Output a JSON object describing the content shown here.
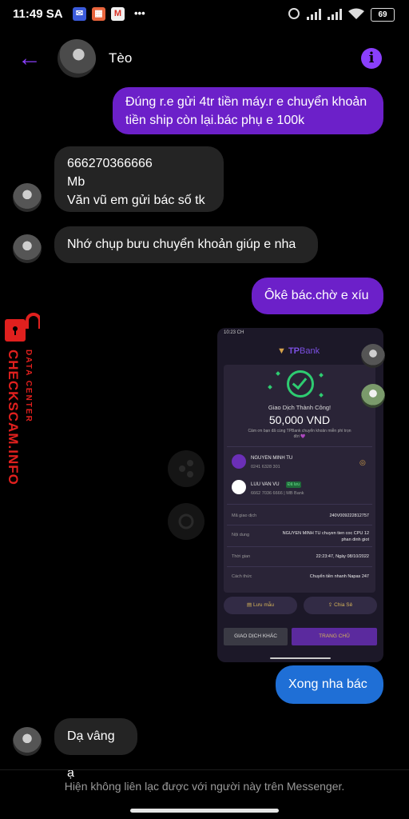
{
  "status_bar": {
    "time": "11:49 SA",
    "app_icons": [
      "messenger-icon",
      "calendar-icon",
      "gmail-icon"
    ],
    "more": "•••",
    "battery": "69"
  },
  "header": {
    "back_icon": "←",
    "contact_name": "Tèo",
    "info_icon": "i"
  },
  "messages": {
    "m1": "Đúng r.e gửi 4tr tiền máy.r e chuyển khoản tiền ship còn lại.bác phụ e 100k",
    "m2_line1": "666270366666",
    "m2_line2": "Mb",
    "m2_line3": "Văn vũ em gửi bác số tk",
    "m3": "Nhớ chụp bưu chuyển khoản giúp e nha",
    "m4": "Ôkê bác.chờ e xíu",
    "m5": "Xong nha bác",
    "m6": "Dạ vâng ạ"
  },
  "watermark": {
    "brand": "CHECKSCAM.INFO",
    "sub": "DATA CENTER"
  },
  "receipt": {
    "status_time": "10:23 CH",
    "logo_tp": "TP",
    "logo_bank": "Bank",
    "success_title": "Giao Dịch Thành Công!",
    "amount": "50,000 VND",
    "thanks": "Cảm ơn bạn đã cùng TPBank chuyển khoản miễn phí trọn đời 💜",
    "sender_name": "NGUYEN MINH TU",
    "sender_acct": "0241 6328 301",
    "receiver_name": "LUU VAN VU",
    "receiver_badge": "Đã lưu",
    "receiver_acct": "6662 7036 6666  |  MB Bank",
    "rows": [
      {
        "label": "Mã giao dịch",
        "value": "240V009222812757"
      },
      {
        "label": "Nội dung",
        "value": "NGUYEN MINH TU chuyen tien coc CPU 12 phan dinh giot"
      },
      {
        "label": "Thời gian",
        "value": "22:23:47, Ngày 08/10/2022"
      },
      {
        "label": "Cách thức",
        "value": "Chuyển tiền nhanh Napas 247"
      }
    ],
    "save_label": "Lưu mẫu",
    "share_label": "Chia Sẻ",
    "other_tx": "GIAO DỊCH KHÁC",
    "home": "TRANG CHỦ"
  },
  "footer": {
    "notice": "Hiện không liên lạc được với người này trên Messenger."
  },
  "colors": {
    "accent": "#8a3ffc",
    "outgoing_bubble": "#6c20c9",
    "incoming_bubble": "#242424",
    "blue_bubble": "#1f6fd6",
    "watermark": "#e0201e"
  }
}
